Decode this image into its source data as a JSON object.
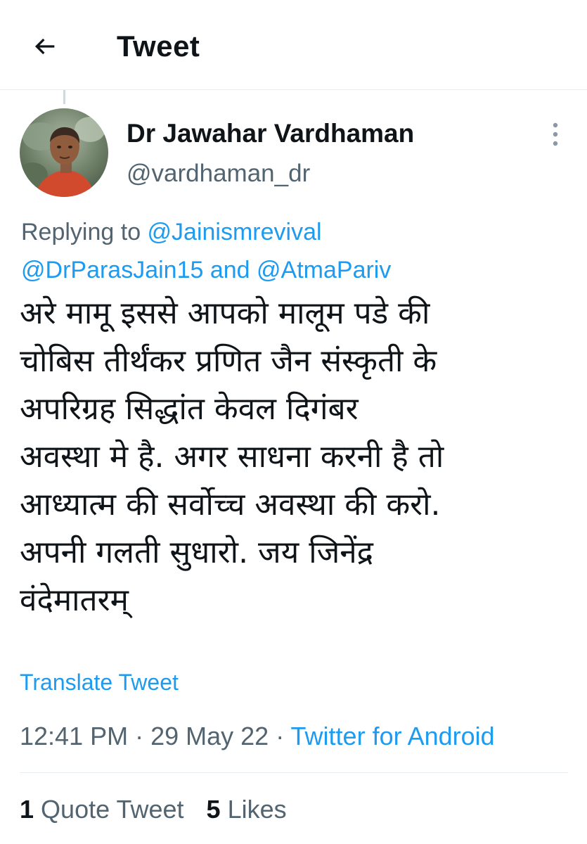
{
  "header": {
    "back_icon": "arrow-left-icon",
    "title": "Tweet"
  },
  "tweet": {
    "author": {
      "display_name": "Dr Jawahar Vardhaman",
      "handle": "@vardhaman_dr",
      "avatar_icon": "profile-photo"
    },
    "more_icon": "more-vertical-icon",
    "replying": {
      "prefix": "Replying to ",
      "mention_1": "@Jainismrevival",
      "mention_2": "@DrParasJain15",
      "conjunction": " and ",
      "mention_3": "@AtmaPariv"
    },
    "text_lines": [
      "अरे मामू इससे आपको मालूम पडे की",
      "चोबिस तीर्थंकर प्रणित जैन संस्कृती के",
      "अपरिग्रह सिद्धांत केवल दिगंबर",
      "अवस्था मे है. अगर साधना करनी है तो",
      "आध्यात्म की सर्वोच्च अवस्था की करो.",
      "अपनी गलती सुधारो. जय जिनेंद्र",
      "वंदेमातरम्"
    ],
    "translate_label": "Translate Tweet",
    "time": "12:41 PM",
    "separator": " · ",
    "date": "29 May 22",
    "source": "Twitter for Android"
  },
  "stats": {
    "quote_count": "1",
    "quote_label": "Quote Tweet",
    "likes_count": "5",
    "likes_label": "Likes"
  },
  "colors": {
    "link": "#1d9bf0",
    "secondary_text": "#536471",
    "primary_text": "#0f1419",
    "divider": "#e6ecf0"
  }
}
